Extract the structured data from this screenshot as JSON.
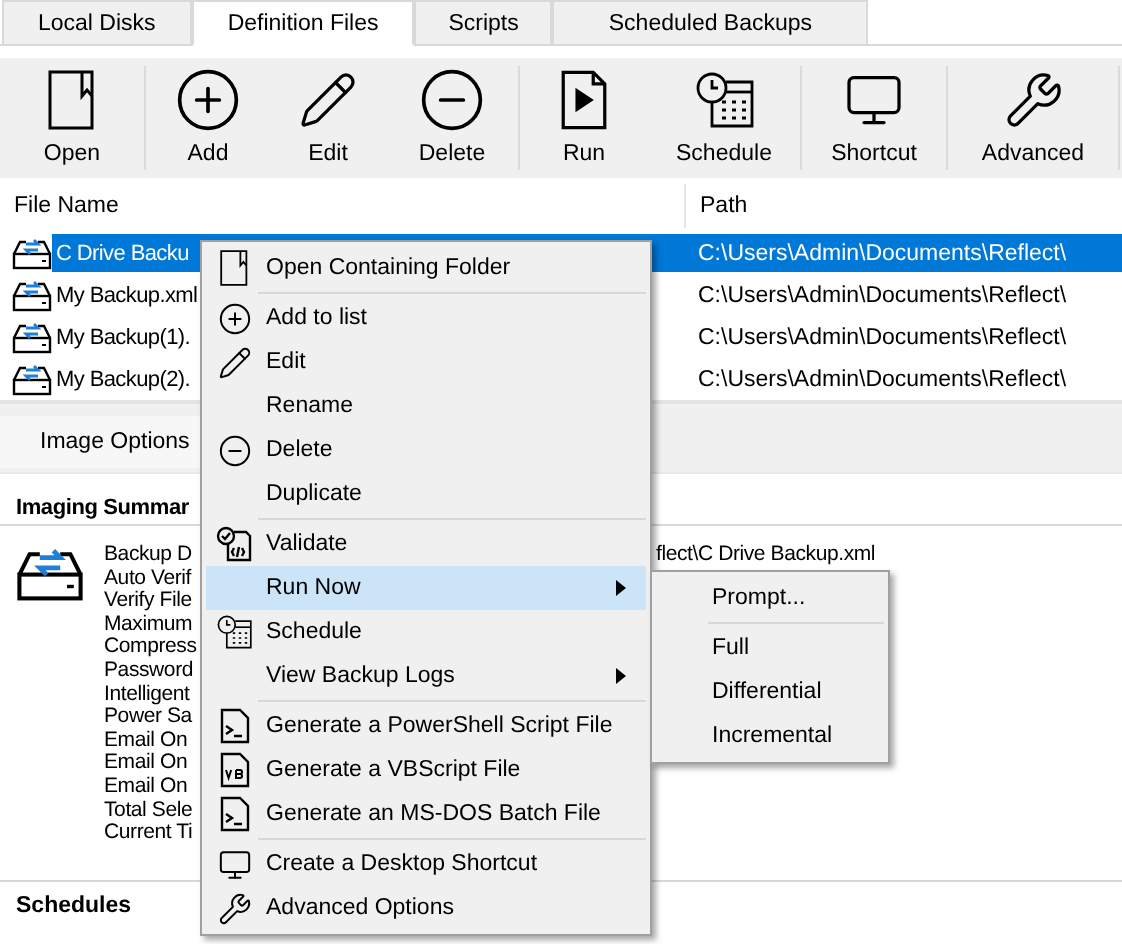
{
  "tabs": [
    {
      "label": "Local Disks",
      "selected": false
    },
    {
      "label": "Definition Files",
      "selected": true
    },
    {
      "label": "Scripts",
      "selected": false
    },
    {
      "label": "Scheduled Backups",
      "selected": false
    }
  ],
  "toolbar": {
    "groups": [
      [
        {
          "label": "Open",
          "kind": "open"
        }
      ],
      [
        {
          "label": "Add",
          "kind": "add"
        },
        {
          "label": "Edit",
          "kind": "edit"
        },
        {
          "label": "Delete",
          "kind": "delete"
        }
      ],
      [
        {
          "label": "Run",
          "kind": "run"
        },
        {
          "label": "Schedule",
          "kind": "schedule"
        }
      ],
      [
        {
          "label": "Shortcut",
          "kind": "shortcut"
        }
      ],
      [
        {
          "label": "Advanced",
          "kind": "advanced"
        }
      ]
    ]
  },
  "file_list": {
    "columns": [
      "File Name",
      "Path"
    ],
    "rows": [
      {
        "name": "C Drive Backu",
        "path": "C:\\Users\\Admin\\Documents\\Reflect\\",
        "selected": true
      },
      {
        "name": "My Backup.xml",
        "path": "C:\\Users\\Admin\\Documents\\Reflect\\",
        "selected": false
      },
      {
        "name": "My Backup(1).",
        "path": "C:\\Users\\Admin\\Documents\\Reflect\\",
        "selected": false
      },
      {
        "name": "My Backup(2).",
        "path": "C:\\Users\\Admin\\Documents\\Reflect\\",
        "selected": false
      }
    ]
  },
  "detail_tabs": [
    {
      "label": "Image Options",
      "selected": true
    }
  ],
  "summary": {
    "heading": "Imaging Summar",
    "first_line_tail": "flect\\C Drive Backup.xml",
    "lines": [
      "Backup D",
      "Auto Verif",
      "Verify File",
      "Maximum",
      "Compress",
      "Password",
      "Intelligent",
      "Power Sa",
      "Email On",
      "Email On",
      "Email On",
      "Total Sele",
      "Current Ti"
    ]
  },
  "schedules": {
    "heading": "Schedules"
  },
  "context_menu": {
    "items": [
      {
        "kind": "open",
        "label": "Open Containing Folder",
        "submenu": false,
        "selected": false
      },
      {
        "kind": "separator"
      },
      {
        "kind": "add",
        "label": "Add to list",
        "submenu": false,
        "selected": false
      },
      {
        "kind": "edit",
        "label": "Edit",
        "submenu": false,
        "selected": false
      },
      {
        "kind": "plain",
        "label": "Rename",
        "submenu": false,
        "selected": false
      },
      {
        "kind": "delete",
        "label": "Delete",
        "submenu": false,
        "selected": false
      },
      {
        "kind": "plain",
        "label": "Duplicate",
        "submenu": false,
        "selected": false
      },
      {
        "kind": "separator"
      },
      {
        "kind": "validate",
        "label": "Validate",
        "submenu": false,
        "selected": false
      },
      {
        "kind": "plain",
        "label": "Run Now",
        "submenu": true,
        "selected": true
      },
      {
        "kind": "schedule",
        "label": "Schedule",
        "submenu": false,
        "selected": false
      },
      {
        "kind": "plain",
        "label": "View Backup Logs",
        "submenu": true,
        "selected": false
      },
      {
        "kind": "separator"
      },
      {
        "kind": "script",
        "label": "Generate a PowerShell Script File",
        "submenu": false,
        "selected": false
      },
      {
        "kind": "vb",
        "label": "Generate a VBScript File",
        "submenu": false,
        "selected": false
      },
      {
        "kind": "script",
        "label": "Generate an MS-DOS Batch File",
        "submenu": false,
        "selected": false
      },
      {
        "kind": "separator"
      },
      {
        "kind": "shortcut",
        "label": "Create a Desktop Shortcut",
        "submenu": false,
        "selected": false
      },
      {
        "kind": "advanced",
        "label": "Advanced Options",
        "submenu": false,
        "selected": false
      }
    ]
  },
  "submenu": {
    "items": [
      {
        "kind": "item",
        "label": "Prompt..."
      },
      {
        "kind": "separator"
      },
      {
        "kind": "item",
        "label": "Full"
      },
      {
        "kind": "item",
        "label": "Differential"
      },
      {
        "kind": "item",
        "label": "Incremental"
      }
    ]
  }
}
